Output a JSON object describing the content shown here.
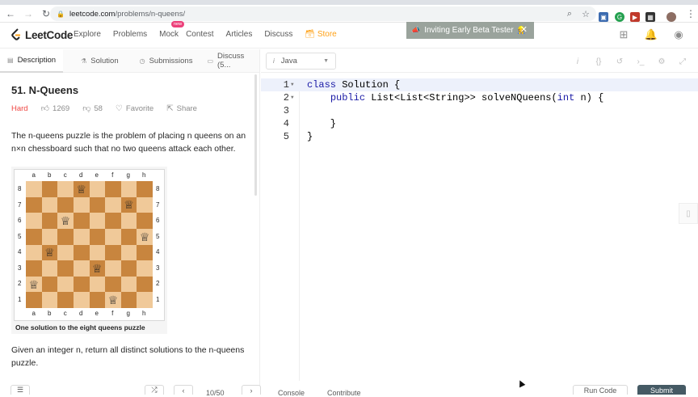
{
  "browser": {
    "url_host": "leetcode.com",
    "url_path": "/problems/n-queens/"
  },
  "nav": {
    "logo": "LeetCode",
    "links": [
      "Explore",
      "Problems",
      "Mock",
      "Contest",
      "Articles",
      "Discuss",
      "Store"
    ],
    "new_badge": "new",
    "beta_banner": "Inviting Early Beta Tester"
  },
  "tabs": [
    "Description",
    "Solution",
    "Submissions",
    "Discuss (5..."
  ],
  "problem": {
    "title": "51. N-Queens",
    "difficulty": "Hard",
    "likes": "1269",
    "dislikes": "58",
    "favorite": "Favorite",
    "share": "Share",
    "description": "The n-queens puzzle is the problem of placing n queens on an n×n chessboard such that no two queens attack each other.",
    "board_files": [
      "a",
      "b",
      "c",
      "d",
      "e",
      "f",
      "g",
      "h"
    ],
    "board_ranks": [
      "8",
      "7",
      "6",
      "5",
      "4",
      "3",
      "2",
      "1"
    ],
    "queens": [
      "d8",
      "g7",
      "c6",
      "h5",
      "b4",
      "e3",
      "a2",
      "f1"
    ],
    "caption": "One solution to the eight queens puzzle",
    "description2": "Given an integer n, return all distinct solutions to the n-queens puzzle."
  },
  "editor": {
    "language": "Java",
    "lines": [
      {
        "num": "1",
        "text": "class Solution {"
      },
      {
        "num": "2",
        "text": "    public List<List<String>> solveNQueens(int n) {"
      },
      {
        "num": "3",
        "text": ""
      },
      {
        "num": "4",
        "text": "    }"
      },
      {
        "num": "5",
        "text": "}"
      }
    ]
  },
  "bottom": {
    "page": "10/50",
    "console": "Console",
    "contribute": "Contribute",
    "run": "Run Code",
    "submit": "Submit"
  }
}
